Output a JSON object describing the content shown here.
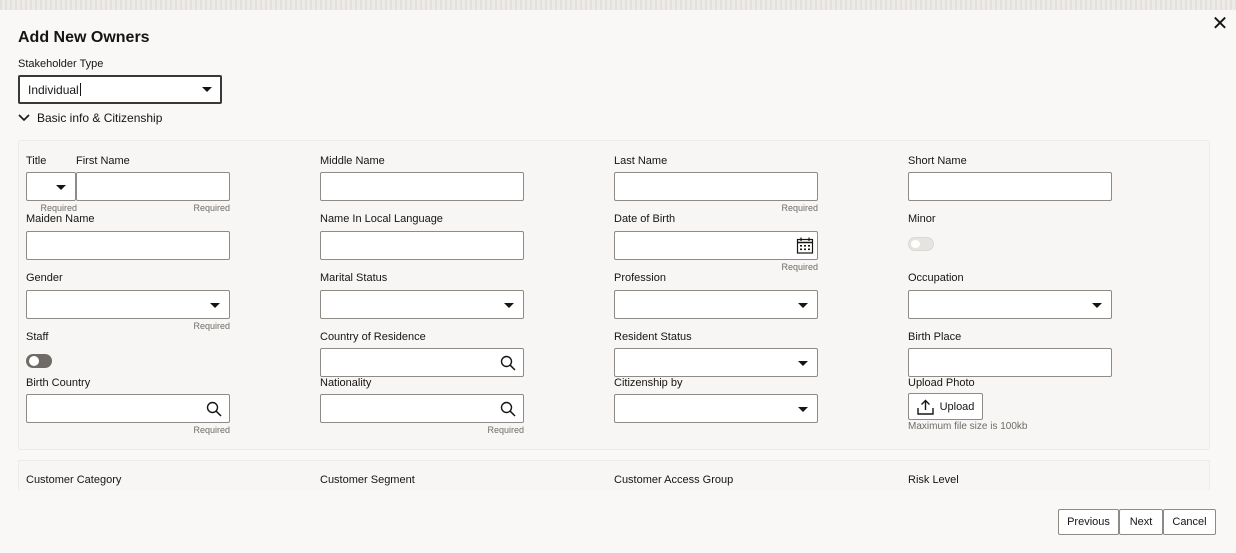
{
  "dialog": {
    "title": "Add New Owners",
    "close_glyph": "✕",
    "stakeholder_type_label": "Stakeholder Type",
    "stakeholder_type_value": "Individual",
    "section_label": "Basic info & Citizenship"
  },
  "required_text": "Required",
  "labels": {
    "title": "Title",
    "first_name": "First Name",
    "middle_name": "Middle Name",
    "last_name": "Last Name",
    "short_name": "Short Name",
    "maiden_name": "Maiden Name",
    "name_local": "Name In Local Language",
    "dob": "Date of Birth",
    "minor": "Minor",
    "gender": "Gender",
    "marital_status": "Marital Status",
    "profession": "Profession",
    "occupation": "Occupation",
    "staff": "Staff",
    "country_residence": "Country of Residence",
    "resident_status": "Resident Status",
    "birth_place": "Birth Place",
    "birth_country": "Birth Country",
    "nationality": "Nationality",
    "citizenship_by": "Citizenship by",
    "upload_photo": "Upload Photo"
  },
  "upload": {
    "button_label": "Upload",
    "hint": "Maximum file size is 100kb"
  },
  "next_section_labels": {
    "customer_category": "Customer Category",
    "customer_segment": "Customer Segment",
    "customer_access_group": "Customer Access Group",
    "risk_level": "Risk Level"
  },
  "footer": {
    "previous": "Previous",
    "next": "Next",
    "cancel": "Cancel"
  },
  "toggles": {
    "minor_on": false,
    "staff_on": false
  },
  "icons": {
    "close": "close-icon",
    "dropdown": "chevron-down-icon",
    "search": "search-icon",
    "calendar": "calendar-icon",
    "upload": "upload-icon",
    "section": "chevron-down-icon"
  }
}
